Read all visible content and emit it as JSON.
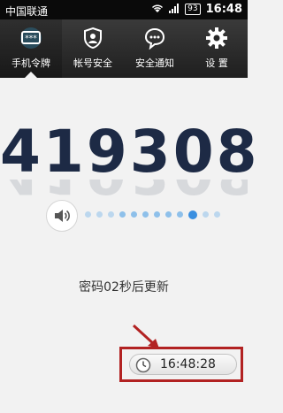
{
  "status_bar": {
    "carrier": "中国联通",
    "battery": "93",
    "time": "16:48"
  },
  "tabs": [
    {
      "label": "手机令牌",
      "icon": "token-card-icon",
      "active": true
    },
    {
      "label": "帐号安全",
      "icon": "shield-icon",
      "active": false
    },
    {
      "label": "安全通知",
      "icon": "chat-bubble-icon",
      "active": false
    },
    {
      "label": "设 置",
      "icon": "gear-icon",
      "active": false
    }
  ],
  "token": {
    "code": "419308",
    "countdown_text": "密码02秒后更新",
    "progress_dots_total": 12,
    "progress_active_index": 9
  },
  "clock": {
    "time": "16:48:28",
    "icon": "clock-icon"
  },
  "colors": {
    "code_color": "#1d2a45",
    "highlight_box": "#b22222",
    "active_dot": "#3a8fe0"
  }
}
